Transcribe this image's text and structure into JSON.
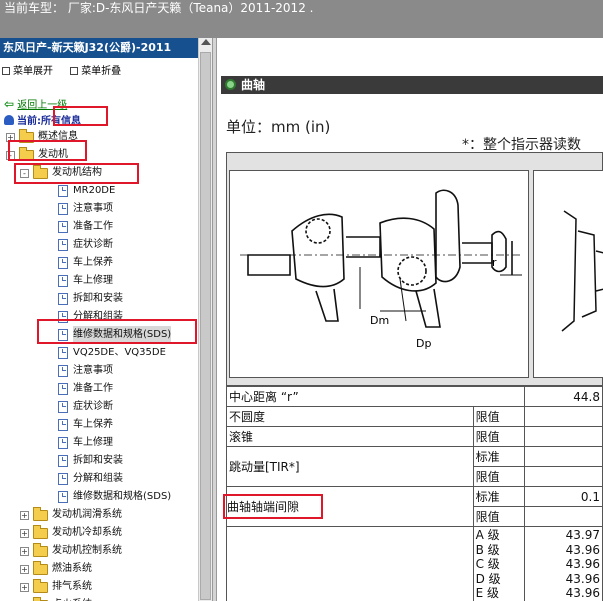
{
  "header": {
    "title": "当前车型：  厂家:D-东风日产天籁（Teana）2011-2012  ."
  },
  "sidebar": {
    "title": "东风日产-新天籁J32(公爵)-2011",
    "expand_label": "菜单展开",
    "collapse_label": "菜单折叠",
    "back_label": "返回上一级",
    "current_prefix": "当前:",
    "current_value": "所有信息"
  },
  "tree": [
    {
      "label": "概述信息",
      "level": 0,
      "type": "folder",
      "expander": "+"
    },
    {
      "label": "发动机",
      "level": 0,
      "type": "folder",
      "expander": "-"
    },
    {
      "label": "发动机结构",
      "level": 1,
      "type": "folder",
      "expander": "-"
    },
    {
      "label": "MR20DE",
      "level": 2,
      "type": "doc"
    },
    {
      "label": "注意事项",
      "level": 2,
      "type": "doc"
    },
    {
      "label": "准备工作",
      "level": 2,
      "type": "doc"
    },
    {
      "label": "症状诊断",
      "level": 2,
      "type": "doc"
    },
    {
      "label": "车上保养",
      "level": 2,
      "type": "doc"
    },
    {
      "label": "车上修理",
      "level": 2,
      "type": "doc"
    },
    {
      "label": "拆卸和安装",
      "level": 2,
      "type": "doc"
    },
    {
      "label": "分解和组装",
      "level": 2,
      "type": "doc"
    },
    {
      "label": "维修数据和规格(SDS)",
      "level": 2,
      "type": "doc",
      "selected": true
    },
    {
      "label": "VQ25DE、VQ35DE",
      "level": 2,
      "type": "doc"
    },
    {
      "label": "注意事项",
      "level": 2,
      "type": "doc"
    },
    {
      "label": "准备工作",
      "level": 2,
      "type": "doc"
    },
    {
      "label": "症状诊断",
      "level": 2,
      "type": "doc"
    },
    {
      "label": "车上保养",
      "level": 2,
      "type": "doc"
    },
    {
      "label": "车上修理",
      "level": 2,
      "type": "doc"
    },
    {
      "label": "拆卸和安装",
      "level": 2,
      "type": "doc"
    },
    {
      "label": "分解和组装",
      "level": 2,
      "type": "doc"
    },
    {
      "label": "维修数据和规格(SDS)",
      "level": 2,
      "type": "doc"
    },
    {
      "label": "发动机润滑系统",
      "level": 1,
      "type": "folder",
      "expander": "+"
    },
    {
      "label": "发动机冷却系统",
      "level": 1,
      "type": "folder",
      "expander": "+"
    },
    {
      "label": "发动机控制系统",
      "level": 1,
      "type": "folder",
      "expander": "+"
    },
    {
      "label": "燃油系统",
      "level": 1,
      "type": "folder",
      "expander": "+"
    },
    {
      "label": "排气系统",
      "level": 1,
      "type": "folder",
      "expander": "+"
    },
    {
      "label": "点火系统",
      "level": 1,
      "type": "folder",
      "expander": "+"
    }
  ],
  "content": {
    "section_title": "曲轴",
    "unit_label": "单位：mm (in)",
    "note": "*：整个指示器读数",
    "figure_labels": {
      "r": "r",
      "dm": "Dm",
      "dp": "Dp"
    },
    "rows": {
      "center_distance": {
        "label": "中心距离 “r”",
        "value": "44.8"
      },
      "out_of_round": {
        "label": "不圆度",
        "sub": "限值"
      },
      "taper": {
        "label": "滚锥",
        "sub": "限值"
      },
      "runout": {
        "label": "跳动量[TIR*]",
        "sub1": "标准",
        "sub2": "限值"
      },
      "end_play": {
        "label": "曲轴轴端间隙",
        "sub1": "标准",
        "value1": "0.1",
        "sub2": "限值"
      },
      "grades": {
        "labels": [
          "A 级",
          "B 级",
          "C 级",
          "D 级",
          "E 级"
        ],
        "values": [
          "43.97",
          "43.96",
          "43.96",
          "43.96",
          "43.96"
        ]
      }
    }
  }
}
